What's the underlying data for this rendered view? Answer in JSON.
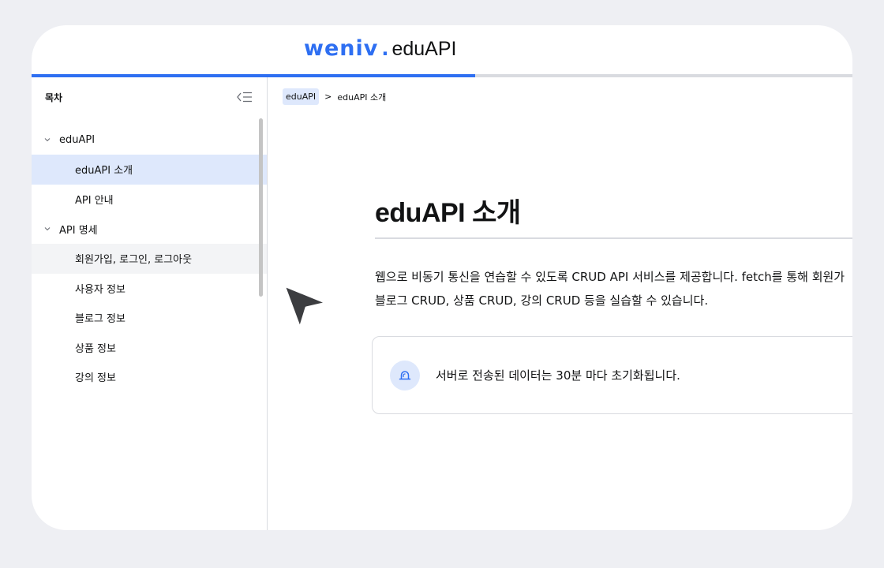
{
  "header": {
    "logo_mark": "weniv",
    "logo_dot": ".",
    "logo_text": "eduAPI",
    "read_progress_percent": 54
  },
  "sidebar": {
    "title": "목차",
    "collapse_icon": "collapse-sidebar-icon",
    "groups": [
      {
        "label": "eduAPI",
        "expanded": true,
        "items": [
          {
            "label": "eduAPI 소개",
            "state": "active"
          },
          {
            "label": "API 안내",
            "state": "default"
          }
        ]
      },
      {
        "label": "API 명세",
        "expanded": true,
        "items": [
          {
            "label": "회원가입, 로그인, 로그아웃",
            "state": "hover"
          },
          {
            "label": "사용자 정보",
            "state": "default"
          },
          {
            "label": "블로그 정보",
            "state": "default"
          },
          {
            "label": "상품 정보",
            "state": "default"
          },
          {
            "label": "강의 정보",
            "state": "default"
          }
        ]
      }
    ]
  },
  "breadcrumb": {
    "items": [
      "eduAPI",
      "eduAPI 소개"
    ],
    "separator": ">"
  },
  "main": {
    "title": "eduAPI 소개",
    "description_line1": "웹으로 비동기 통신을 연습할 수 있도록 CRUD API 서비스를 제공합니다. fetch를 통해 회원가",
    "description_line2": "블로그 CRUD, 상품 CRUD, 강의 CRUD 등을 실습할 수 있습니다.",
    "notice_icon": "alarm-siren-icon",
    "notice_text": "서버로 전송된 데이터는 30분 마다 초기화됩니다."
  },
  "colors": {
    "accent": "#2e6ff2",
    "active_bg": "#dee8fc",
    "hover_bg": "#f3f4f6",
    "border": "#d9dbe0",
    "page_bg": "#eeeff3"
  }
}
